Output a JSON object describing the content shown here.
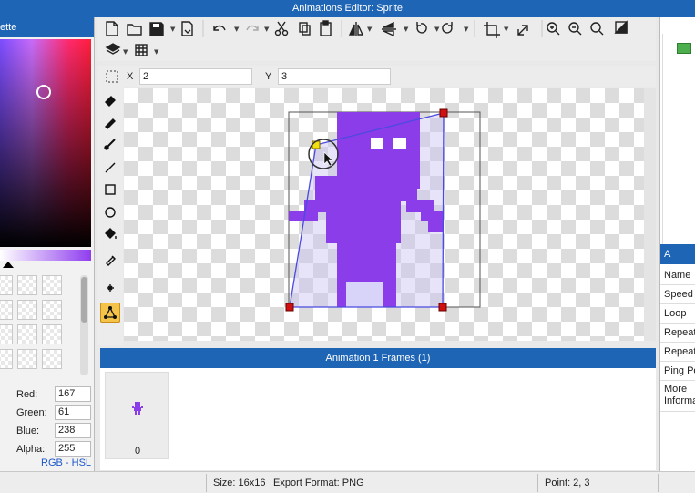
{
  "window": {
    "title": "Animations Editor: Sprite"
  },
  "palette": {
    "title": "ette",
    "red_label": "Red:",
    "red": "167",
    "green_label": "Green:",
    "green": "61",
    "blue_label": "Blue:",
    "blue": "238",
    "alpha_label": "Alpha:",
    "alpha": "255",
    "rgb_link": "RGB",
    "separator": "-",
    "hsl_link": "HSL"
  },
  "coords": {
    "x_label": "X",
    "x_value": "2",
    "y_label": "Y",
    "y_value": "3"
  },
  "toolbar": {
    "icons": [
      "new-file-icon",
      "open-folder-icon",
      "save-icon",
      "export-icon",
      "undo-icon",
      "redo-icon",
      "cut-icon",
      "copy-icon",
      "paste-icon",
      "flip-horizontal-icon",
      "flip-vertical-icon",
      "rotate-left-icon",
      "rotate-right-icon",
      "crop-icon",
      "resize-icon",
      "zoom-in-icon",
      "zoom-out-icon",
      "zoom-fit-icon",
      "contrast-icon",
      "layers-icon",
      "grid-icon"
    ]
  },
  "tools": [
    "eraser-icon",
    "pencil-icon",
    "brush-icon",
    "line-icon",
    "rectangle-icon",
    "ellipse-icon",
    "fill-icon",
    "eyedropper-icon",
    "transform-icon",
    "perspective-icon"
  ],
  "frames": {
    "title": "Animation 1 Frames (1)",
    "items": [
      {
        "index": "0"
      }
    ]
  },
  "properties": {
    "title": "A",
    "items": [
      "Name",
      "Speed",
      "Loop",
      "Repeat",
      "Repeat",
      "Ping Po",
      "More Informa"
    ]
  },
  "status": {
    "size": "Size: 16x16",
    "export": "Export Format: PNG",
    "point": "Point: 2, 3"
  },
  "colors": {
    "accent": "#1f65b5",
    "sprite": "#8a3de9",
    "active_tool": "#f5c24a"
  }
}
